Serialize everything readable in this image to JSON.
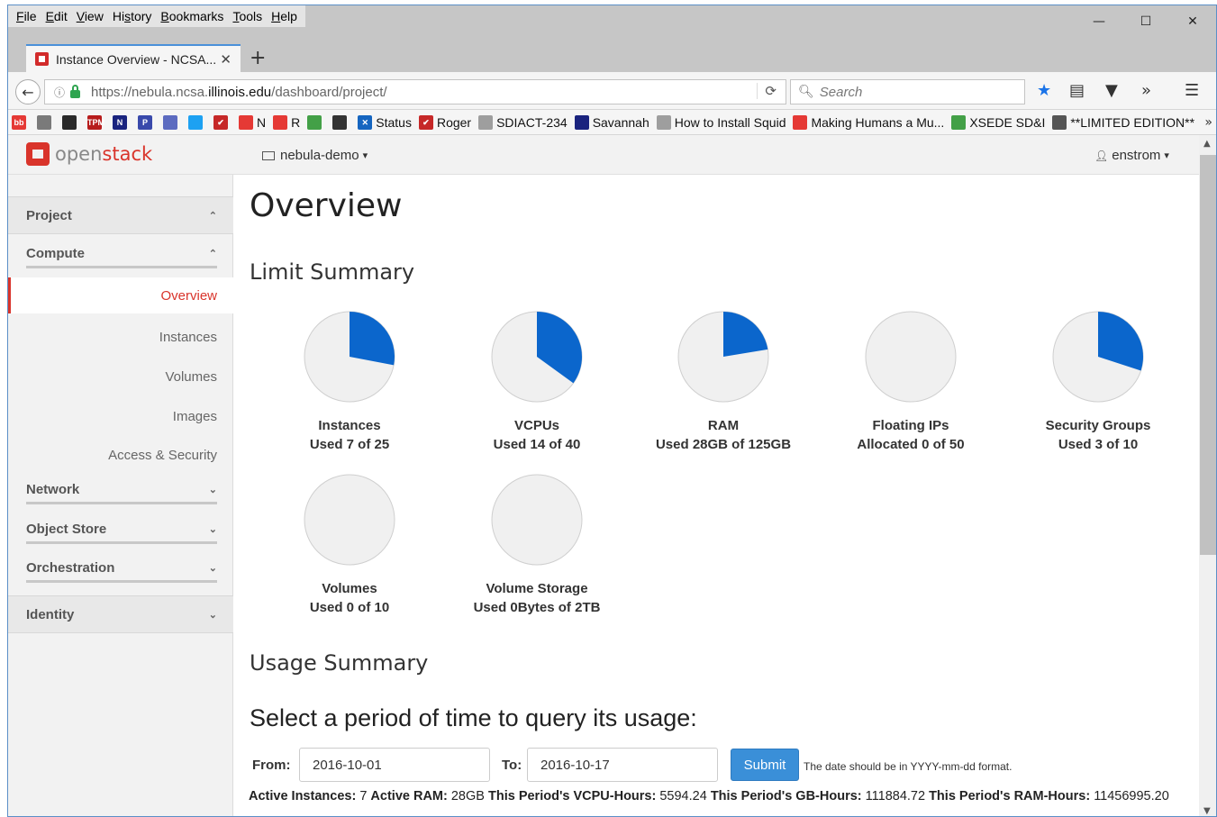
{
  "menubar": {
    "items": [
      {
        "label": "File",
        "u": "F",
        "rest": "ile"
      },
      {
        "label": "Edit",
        "u": "E",
        "rest": "dit"
      },
      {
        "label": "View",
        "u": "V",
        "rest": "iew"
      },
      {
        "label": "History",
        "u": "H",
        "rest": "istory",
        "pre": "Hi",
        "u2": "s",
        "rest2": "tory"
      },
      {
        "label": "Bookmarks",
        "u": "B",
        "rest": "ookmarks"
      },
      {
        "label": "Tools",
        "u": "T",
        "rest": "ools"
      },
      {
        "label": "Help",
        "u": "H",
        "rest": "elp"
      }
    ]
  },
  "window_controls": {
    "minimize": "—",
    "maximize": "☐",
    "close": "✕"
  },
  "tab": {
    "title": "Instance Overview - NCSA...",
    "close": "✕",
    "new_tab": "+"
  },
  "navbar": {
    "back": "🡐",
    "url_prefix": "https://nebula.ncsa.",
    "url_domain": "illinois.edu",
    "url_suffix": "/dashboard/project/",
    "reload": "⟳",
    "search_placeholder": "Search"
  },
  "bookmarks": [
    {
      "label": "",
      "color": "#e53935",
      "text_icon": "bb"
    },
    {
      "label": "",
      "color": "#7a7a7a"
    },
    {
      "label": "",
      "color": "#2a2a2a"
    },
    {
      "label": "",
      "color": "#b71c1c",
      "text_icon": "TPM"
    },
    {
      "label": "",
      "color": "#1a237e",
      "text_icon": "N"
    },
    {
      "label": "",
      "color": "#3949ab",
      "text_icon": "P"
    },
    {
      "label": "",
      "color": "#5c6bc0"
    },
    {
      "label": "",
      "color": "#1da1f2"
    },
    {
      "label": "",
      "color": "#c62828",
      "text_icon": "✔"
    },
    {
      "label": "N",
      "color": "#e53935"
    },
    {
      "label": "R",
      "color": "#e53935"
    },
    {
      "label": "",
      "color": "#43a047"
    },
    {
      "label": "",
      "color": "#333333"
    },
    {
      "label": "Status",
      "color": "#1565c0",
      "text_icon": "✕"
    },
    {
      "label": "Roger",
      "color": "#c62828",
      "text_icon": "✔"
    },
    {
      "label": "SDIACT-234",
      "color": "#9e9e9e"
    },
    {
      "label": "Savannah",
      "color": "#1a237e"
    },
    {
      "label": "How to Install Squid",
      "color": "#9e9e9e"
    },
    {
      "label": "Making Humans a Mu...",
      "color": "#e53935"
    },
    {
      "label": "XSEDE SD&I",
      "color": "#43a047"
    },
    {
      "label": "**LIMITED EDITION**",
      "color": "#555555"
    }
  ],
  "bookmarks_more": "»",
  "openstack": {
    "logo_open": "open",
    "logo_stack": "stack",
    "project": "nebula-demo",
    "user": "enstrom",
    "caret": "▾"
  },
  "sidebar": {
    "project": "Project",
    "compute": "Compute",
    "compute_items": [
      "Overview",
      "Instances",
      "Volumes",
      "Images",
      "Access & Security"
    ],
    "network": "Network",
    "object_store": "Object Store",
    "orchestration": "Orchestration",
    "identity": "Identity",
    "chev_up": "⌃",
    "chev_down": "⌄"
  },
  "main": {
    "title": "Overview",
    "limit_summary": "Limit Summary",
    "usage_summary": "Usage Summary",
    "period_title": "Select a period of time to query its usage:",
    "from_label": "From:",
    "from_value": "2016-10-01",
    "to_label": "To:",
    "to_value": "2016-10-17",
    "submit": "Submit",
    "hint": "The date should be in YYYY-mm-dd format.",
    "stats": [
      {
        "label": "Active Instances:",
        "value": "7"
      },
      {
        "label": "Active RAM:",
        "value": "28GB"
      },
      {
        "label": "This Period's VCPU-Hours:",
        "value": "5594.24"
      },
      {
        "label": "This Period's GB-Hours:",
        "value": "111884.72"
      },
      {
        "label": "This Period's RAM-Hours:",
        "value": "11456995.20"
      }
    ]
  },
  "limits": [
    {
      "name": "Instances",
      "usage": "Used 7 of 25",
      "fraction": 0.28
    },
    {
      "name": "VCPUs",
      "usage": "Used 14 of 40",
      "fraction": 0.35
    },
    {
      "name": "RAM",
      "usage": "Used 28GB of 125GB",
      "fraction": 0.224
    },
    {
      "name": "Floating IPs",
      "usage": "Allocated 0 of 50",
      "fraction": 0
    },
    {
      "name": "Security Groups",
      "usage": "Used 3 of 10",
      "fraction": 0.3
    },
    {
      "name": "Volumes",
      "usage": "Used 0 of 10",
      "fraction": 0
    },
    {
      "name": "Volume Storage",
      "usage": "Used 0Bytes of 2TB",
      "fraction": 0
    }
  ],
  "colors": {
    "pie_used": "#0b66cc",
    "pie_free": "#f0f0f0",
    "pie_stroke": "#cfcfcf",
    "brand_red": "#d9342b"
  }
}
